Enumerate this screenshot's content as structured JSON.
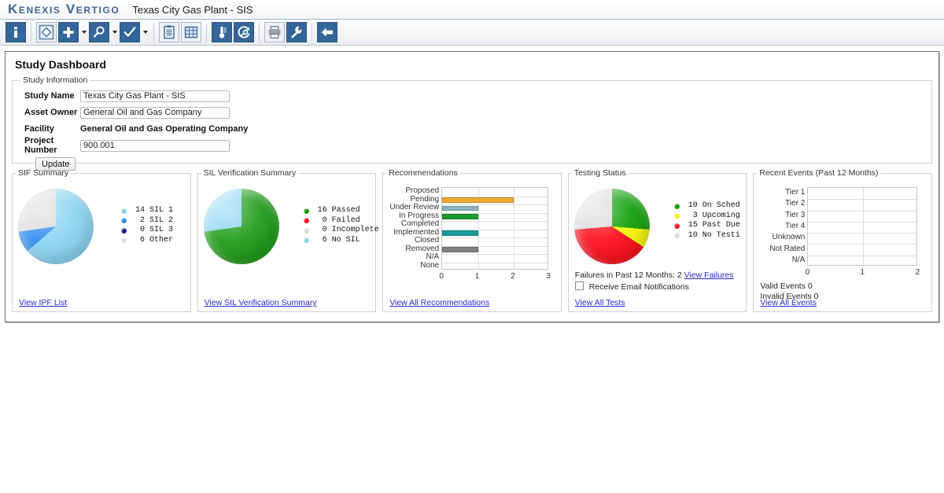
{
  "titlebar": {
    "logo": "Kenexis Vertigo",
    "document_title": "Texas City Gas Plant - SIS"
  },
  "toolbar": {
    "buttons": [
      {
        "name": "info-icon",
        "label": "Information"
      },
      {
        "name": "diamond-node-icon",
        "label": "Node"
      },
      {
        "name": "plus-icon",
        "label": "Add"
      },
      {
        "name": "search-icon",
        "label": "Find"
      },
      {
        "name": "checkmark-icon",
        "label": "Validate"
      },
      {
        "name": "clipboard-icon",
        "label": "Reports"
      },
      {
        "name": "grid-table-icon",
        "label": "Table"
      },
      {
        "name": "thermometer-icon",
        "label": "Instrument"
      },
      {
        "name": "loop-wrench-icon",
        "label": "Loop"
      },
      {
        "name": "printer-icon",
        "label": "Print"
      },
      {
        "name": "wrench-icon",
        "label": "Tools"
      },
      {
        "name": "back-arrow-icon",
        "label": "Back"
      }
    ]
  },
  "page": {
    "title": "Study Dashboard"
  },
  "study_information": {
    "legend": "Study Information",
    "fields": [
      {
        "label": "Study Name",
        "value": "Texas City Gas Plant - SIS",
        "editable": true
      },
      {
        "label": "Asset Owner",
        "value": "General Oil and Gas Company",
        "editable": true
      },
      {
        "label": "Facility",
        "value": "General Oil and Gas Operating Company",
        "editable": false
      },
      {
        "label": "Project Number",
        "value": "900.001",
        "editable": true
      }
    ],
    "update_label": "Update"
  },
  "sif_summary": {
    "legend": "SIF Summary",
    "link": "View IPF List",
    "chart_data": {
      "type": "pie",
      "title": "SIF Summary",
      "categories": [
        "SIL 1",
        "SIL 2",
        "SIL 3",
        "Other"
      ],
      "values": [
        14,
        2,
        0,
        6
      ],
      "colors": [
        "#8BD5F2",
        "#2E8DEE",
        "#101C8C",
        "#DCDCDC"
      ],
      "total": 22,
      "legend_position": "right",
      "start_angle": 0,
      "direction": "clockwise"
    }
  },
  "sil_verification_summary": {
    "legend": "SIL Verification Summary",
    "link": "View SIL Verification Summary",
    "chart_data": {
      "type": "pie",
      "title": "SIL Verification Summary",
      "categories": [
        "Passed",
        "Failed",
        "Incomplete",
        "No SIL"
      ],
      "values": [
        16,
        0,
        0,
        6
      ],
      "colors": [
        "#1E9B17",
        "#FC0D1B",
        "#D9D9D9",
        "#8BD5F2"
      ],
      "total": 22,
      "legend_position": "right",
      "start_angle": 0,
      "direction": "clockwise"
    }
  },
  "recommendations": {
    "legend": "Recommendations",
    "link": "View All Recommendations",
    "chart_data": {
      "type": "bar",
      "orientation": "horizontal",
      "title": "Recommendations",
      "categories": [
        "Proposed",
        "Pending",
        "Under Review",
        "In Progress",
        "Completed",
        "Implemented",
        "Closed",
        "Removed",
        "N/A",
        "None"
      ],
      "values": [
        0,
        2,
        1,
        1,
        0,
        1,
        0,
        1,
        0,
        0
      ],
      "colors": [
        "#F0A830",
        "#F0A830",
        "#8CB4C4",
        "#1E9B2E",
        "#8CB4C4",
        "#1B9B9B",
        "#8CB4C4",
        "#808080",
        "#8CB4C4",
        "#8CB4C4"
      ],
      "xlabel": "",
      "ylabel": "",
      "xlim": [
        0,
        3
      ],
      "xticks": [
        "0",
        "1",
        "2",
        "3"
      ],
      "grid": true
    }
  },
  "testing_status": {
    "legend": "Testing Status",
    "failures_text": "Failures in Past 12 Months: 2",
    "failures_link": "View Failures",
    "checkbox_label": "Receive Email Notifications",
    "checkbox_checked": false,
    "link": "View All Tests",
    "chart_data": {
      "type": "pie",
      "title": "Testing Status",
      "categories": [
        "On Sched",
        "Upcoming",
        "Past Due",
        "No Testi"
      ],
      "values": [
        10,
        3,
        15,
        10
      ],
      "colors": [
        "#11A00B",
        "#F7F709",
        "#FC0D1B",
        "#DCDCDC"
      ],
      "total": 38,
      "legend_position": "right",
      "start_angle": 0,
      "direction": "clockwise"
    }
  },
  "recent_events": {
    "legend": "Recent Events (Past 12 Months)",
    "valid_events": "Valid Events 0",
    "invalid_events": "Invalid Events 0",
    "link": "View All Events",
    "chart_data": {
      "type": "bar",
      "orientation": "horizontal",
      "title": "Recent Events (Past 12 Months)",
      "categories": [
        "Tier 1",
        "Tier 2",
        "Tier 3",
        "Tier 4",
        "Unknown",
        "Not Rated",
        "N/A"
      ],
      "values": [
        0,
        0,
        0,
        0,
        0,
        0,
        0
      ],
      "colors": [
        "#808080",
        "#808080",
        "#808080",
        "#808080",
        "#808080",
        "#808080",
        "#808080"
      ],
      "xlabel": "",
      "ylabel": "",
      "xlim": [
        0,
        2
      ],
      "xticks": [
        "0",
        "1",
        "2"
      ],
      "grid": true
    }
  }
}
